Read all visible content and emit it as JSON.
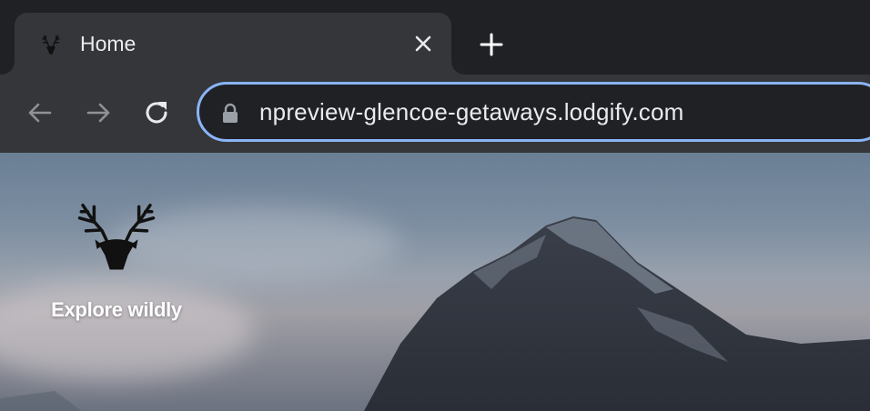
{
  "browser": {
    "tab": {
      "title": "Home",
      "favicon_icon": "stag-head-icon",
      "close_icon": "close-icon"
    },
    "new_tab_icon": "plus-icon",
    "nav": {
      "back_icon": "arrow-left-icon",
      "forward_icon": "arrow-right-icon",
      "reload_icon": "reload-icon"
    },
    "address_bar": {
      "url": "npreview-glencoe-getaways.lodgify.com",
      "lock_icon": "lock-icon"
    },
    "colors": {
      "frame": "#202124",
      "toolbar": "#35363a",
      "omnibox_focus": "#8ab4f8",
      "text": "#e8eaed"
    }
  },
  "page": {
    "logo_icon": "stag-head-icon",
    "tagline": "Explore wildly",
    "hero_image": "mountain-peak-photo"
  }
}
